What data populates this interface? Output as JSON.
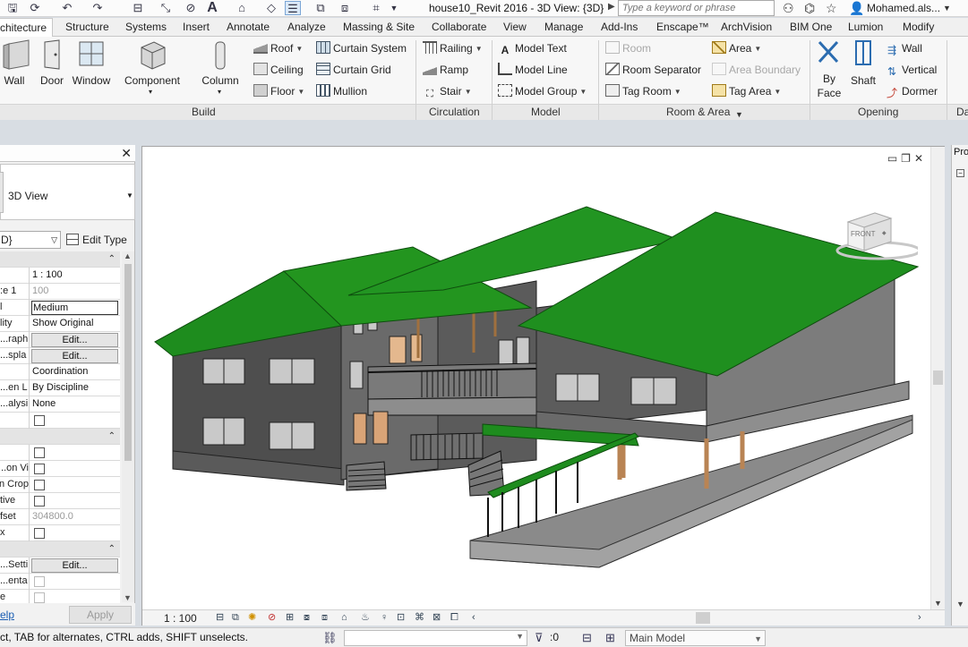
{
  "titlebar": {
    "document_title": "house10_Revit 2016 - 3D View: {3D}",
    "search_placeholder": "Type a keyword or phrase",
    "user": "Mohamed.als...",
    "qat_text_tool": "A"
  },
  "ribbon_tabs": [
    {
      "label": "chitecture",
      "active": true
    },
    {
      "label": "Structure"
    },
    {
      "label": "Systems"
    },
    {
      "label": "Insert"
    },
    {
      "label": "Annotate"
    },
    {
      "label": "Analyze"
    },
    {
      "label": "Massing & Site"
    },
    {
      "label": "Collaborate"
    },
    {
      "label": "View"
    },
    {
      "label": "Manage"
    },
    {
      "label": "Add-Ins"
    },
    {
      "label": "Enscape™"
    },
    {
      "label": "ArchVision"
    },
    {
      "label": "BIM One"
    },
    {
      "label": "Lumion"
    },
    {
      "label": "Modify"
    }
  ],
  "ribbon": {
    "build": {
      "title": "Build",
      "big": [
        "Wall",
        "Door",
        "Window",
        "Component",
        "Column"
      ],
      "roof": "Roof",
      "ceiling": "Ceiling",
      "floor": "Floor",
      "curtain_system": "Curtain System",
      "curtain_grid": "Curtain Grid",
      "mullion": "Mullion"
    },
    "circulation": {
      "title": "Circulation",
      "railing": "Railing",
      "ramp": "Ramp",
      "stair": "Stair"
    },
    "model": {
      "title": "Model",
      "text": "Model Text",
      "line": "Model Line",
      "group": "Model Group"
    },
    "room_area": {
      "title": "Room & Area",
      "room": "Room",
      "room_separator": "Room Separator",
      "tag_room": "Tag Room",
      "area": "Area",
      "area_boundary": "Area Boundary",
      "tag_area": "Tag Area"
    },
    "opening": {
      "title": "Opening",
      "by_face": [
        "By",
        "Face"
      ],
      "shaft": "Shaft",
      "wall": "Wall",
      "vertical": "Vertical",
      "dormer": "Dormer"
    },
    "datum_partial": "Da"
  },
  "properties": {
    "type_name": "3D View",
    "instance": "D}",
    "edit_type": "Edit Type",
    "rows": [
      {
        "k": "",
        "v": "",
        "group": true
      },
      {
        "k": "",
        "v": "1 : 100"
      },
      {
        "k": "e 1:",
        "v": "100",
        "style": "grey"
      },
      {
        "k": "l",
        "v": "Medium",
        "style": "boxed"
      },
      {
        "k": "lity",
        "v": "Show Original"
      },
      {
        "k": "raph...",
        "v": "Edit...",
        "style": "btn"
      },
      {
        "k": "spla...",
        "v": "Edit...",
        "style": "btn"
      },
      {
        "k": "",
        "v": "Coordination"
      },
      {
        "k": "en L...",
        "v": "By Discipline"
      },
      {
        "k": "alysi...",
        "v": "None"
      },
      {
        "k": "",
        "v": "",
        "style": "chk"
      },
      {
        "k": "",
        "v": "",
        "group": true
      },
      {
        "k": "",
        "v": "",
        "style": "chk"
      },
      {
        "k": "on Vi...",
        "v": "",
        "style": "chk"
      },
      {
        "k": "n Crop",
        "v": "",
        "style": "chk"
      },
      {
        "k": "tive",
        "v": "",
        "style": "chk"
      },
      {
        "k": "fset",
        "v": "304800.0",
        "style": "grey"
      },
      {
        "k": "x",
        "v": "",
        "style": "chk"
      },
      {
        "k": "",
        "v": "",
        "group": true
      },
      {
        "k": "Setti...",
        "v": "Edit...",
        "style": "btn"
      },
      {
        "k": "enta...",
        "v": "",
        "style": "chkdim"
      },
      {
        "k": "e",
        "v": "",
        "style": "chkdim"
      }
    ],
    "help": "elp",
    "apply": "Apply"
  },
  "view": {
    "scale": "1 : 100",
    "viewcube_face": "FRONT"
  },
  "project_browser": {
    "title": "Pro"
  },
  "status": {
    "message": "ct, TAB for alternates, CTRL adds, SHIFT unselects.",
    "filter_count": ":0",
    "model": "Main Model"
  },
  "colors": {
    "roof_green": "#1e8c1e",
    "wall_grey": "#4d4d4d",
    "ribbon_bg": "#f7f7f7",
    "link_blue": "#1a5db3"
  }
}
